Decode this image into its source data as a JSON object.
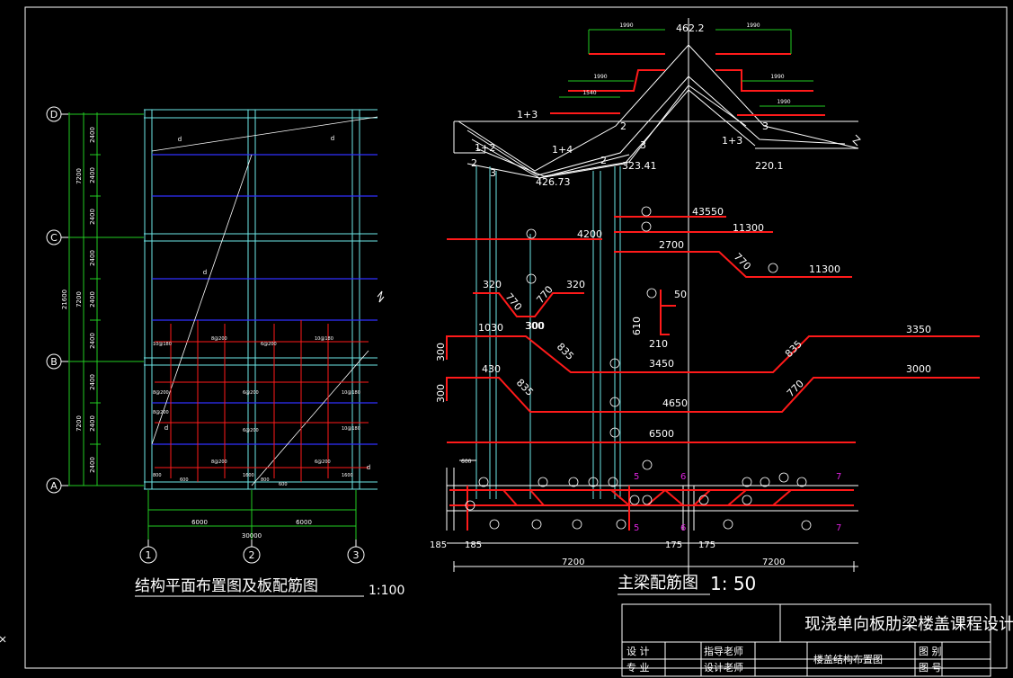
{
  "colors": {
    "background": "#000000",
    "frame": "#ffffff",
    "grid_cyan": "#6ee7e7",
    "beam_blue": "#3030ff",
    "dim_green": "#22cc22",
    "rebar_red": "#ff1a1a",
    "magenta": "#dd22dd",
    "text_white": "#ffffff"
  },
  "left_drawing": {
    "title": "结构平面布置图及板配筋图",
    "scale": "1:100",
    "axis_rows": [
      "D",
      "C",
      "B",
      "A"
    ],
    "axis_cols": [
      "1",
      "2",
      "3"
    ],
    "dims_left_outer": "21600",
    "dims_left_mid": [
      "7200",
      "7200",
      "7200"
    ],
    "dims_left_inner": [
      "2400",
      "2400",
      "2400",
      "2400",
      "2400",
      "2400",
      "2400",
      "2400",
      "2400"
    ],
    "dims_bottom": [
      "6000",
      "6000"
    ],
    "dims_bottom_total": "30000",
    "diag_labels": [
      "d",
      "d",
      "d",
      "d",
      "d"
    ],
    "slab_labels": [
      "10@180",
      "8@200",
      "6@200",
      "10@180",
      "8@200",
      "6@200",
      "10@180",
      "8@200",
      "6@200",
      "10@180",
      "8@200",
      "6@200"
    ],
    "small_dims": [
      "800",
      "600",
      "1600",
      "800",
      "600",
      "1600"
    ]
  },
  "right_drawing": {
    "title": "主梁配筋图",
    "scale": "1: 50",
    "moment_top": "462.2",
    "moment_vals": [
      "323.41",
      "426.73",
      "220.1"
    ],
    "load_labels": [
      "1+3",
      "1+2",
      "1+4",
      "1+3"
    ],
    "small_marks": [
      "2",
      "3",
      "2",
      "2",
      "3",
      "3"
    ],
    "green_dims": [
      "1990",
      "1990",
      "1990",
      "1990",
      "1540",
      "1990"
    ],
    "bars": [
      {
        "id": "1",
        "len": "43550"
      },
      {
        "id": "2",
        "len": "11300"
      },
      {
        "id": "3",
        "len": "4200"
      },
      {
        "id": "4",
        "len": "2700"
      },
      {
        "id": "4b",
        "len": "11300"
      }
    ],
    "bent_770": "770",
    "bar5": {
      "a": "320",
      "b": "770",
      "c": "300",
      "d": "770",
      "e": "320"
    },
    "stirrup": {
      "a": "50",
      "b": "610",
      "c": "210"
    },
    "bar6": {
      "a": "1030",
      "b": "300",
      "c": "835",
      "d": "3450",
      "e": "835",
      "f": "3350",
      "g": "300"
    },
    "bar7": {
      "a": "430",
      "b": "300",
      "c": "835",
      "d": "4650",
      "e": "770",
      "f": "3000"
    },
    "bar8": "6500",
    "beam_dims": [
      "185",
      "185",
      "175",
      "175",
      "7200",
      "7200",
      "600"
    ],
    "section_marks": [
      "5",
      "6",
      "7",
      "5",
      "6",
      "7"
    ]
  },
  "title_block": {
    "project": "现浇单向板肋梁楼盖课程设计",
    "row_labels": [
      "设  计",
      "指导老师",
      "楼盖结构布置图",
      "图  别"
    ],
    "row2": [
      "专  业",
      "设计老师",
      "",
      "图  号"
    ]
  }
}
